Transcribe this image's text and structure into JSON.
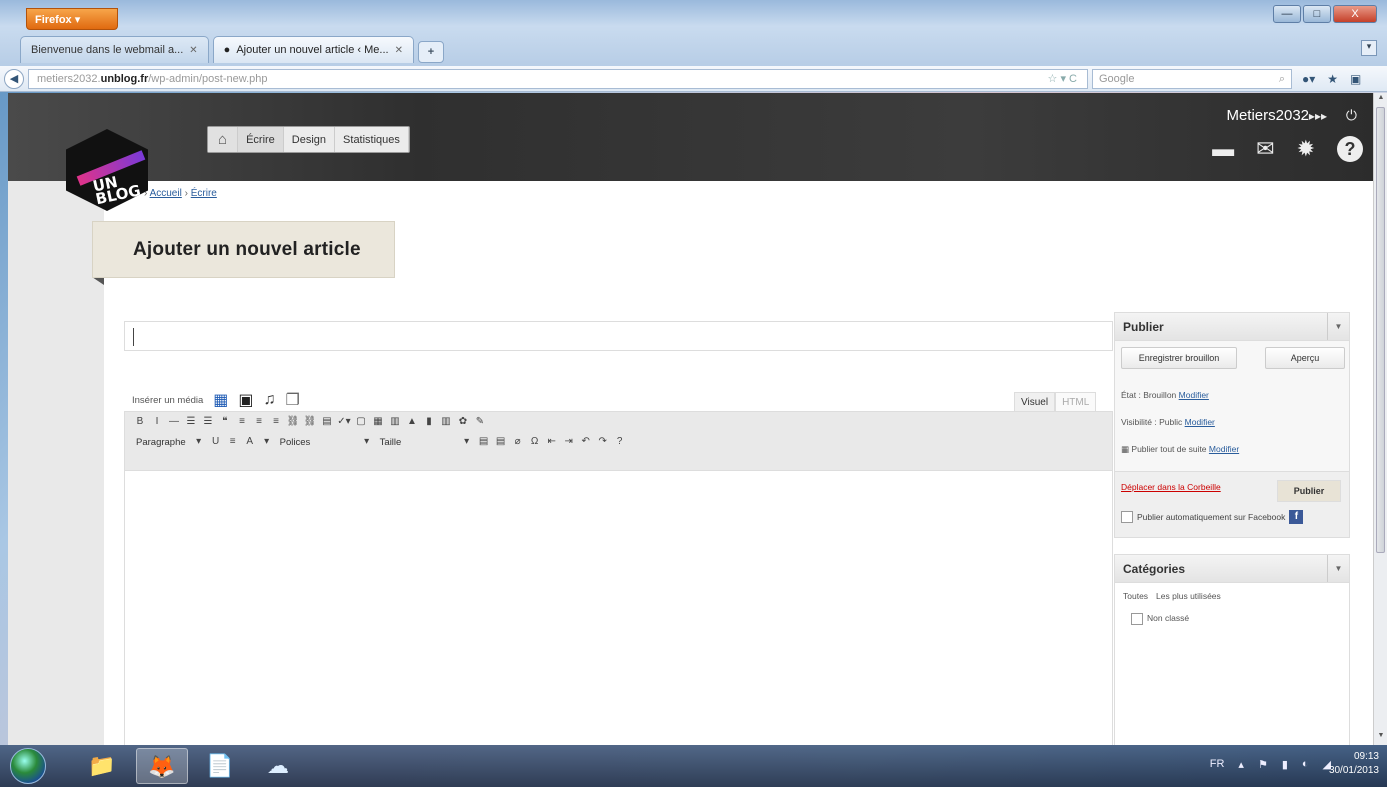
{
  "browser": {
    "menu_button": "Firefox ▾",
    "tabs": [
      {
        "label": "Bienvenue dans le webmail a...",
        "active": false
      },
      {
        "label": "Ajouter un nouvel article ‹ Me...",
        "active": true
      }
    ],
    "newtab_label": "+",
    "url_prefix": "metiers2032.",
    "url_domain": "unblog.fr",
    "url_path": "/wp-admin/post-new.php",
    "url_icons": "☆ ▾ C",
    "search_placeholder": "Google",
    "search_icon": "⌕",
    "window_controls": {
      "minimize": "—",
      "maximize": "□",
      "close": "X"
    },
    "nav_icons": [
      "⚲",
      "●▾",
      "★",
      "▣"
    ]
  },
  "site": {
    "logo_text": "UN BLOG",
    "menu": {
      "home_icon": "⌂",
      "items": [
        "Écrire",
        "Design",
        "Statistiques"
      ]
    },
    "username": "Metiers2032",
    "user_arrows": "▸▸▸",
    "power_icon": "⏻",
    "header_icons": [
      "▬",
      "✉",
      "✹",
      "?"
    ]
  },
  "breadcrumb": {
    "sep": "›",
    "items": [
      "Accueil",
      "Écrire"
    ]
  },
  "page_title": "Ajouter un nouvel article",
  "editor": {
    "media_label": "Insérer un média",
    "media_icons": [
      "▦",
      "▣",
      "♫",
      "❐"
    ],
    "tabs": {
      "visual": "Visuel",
      "html": "HTML"
    },
    "toolbar_row1": [
      "B",
      "I",
      "—",
      "☰",
      "☰",
      "❝",
      "≡",
      "≡",
      "≡",
      "⛓",
      "⛓",
      "▤",
      "✓▾",
      "▢",
      "▦",
      "▥",
      "▲",
      "▮",
      "▥",
      "✿",
      "✎"
    ],
    "toolbar_row2": {
      "format_select": "Paragraphe",
      "buttons_a": [
        "U",
        "≡",
        "A"
      ],
      "font_select": "Polices",
      "size_select": "Taille",
      "buttons_b": [
        "▤",
        "▤",
        "⌀",
        "Ω",
        "⇤",
        "⇥",
        "↶",
        "↷",
        "?"
      ]
    }
  },
  "publish": {
    "title": "Publier",
    "save_draft": "Enregistrer brouillon",
    "preview": "Aperçu",
    "status_label": "État : Brouillon",
    "visibility_label": "Visibilité : Public",
    "schedule_label": "Publier tout de suite",
    "modify": "Modifier",
    "trash": "Déplacer dans la Corbeille",
    "publish_button": "Publier",
    "facebook_label": "Publier automatiquement sur Facebook",
    "facebook_icon": "f"
  },
  "categories": {
    "title": "Catégories",
    "tabs": [
      "Toutes",
      "Les plus utilisées"
    ],
    "items": [
      "Non classé"
    ]
  },
  "taskbar": {
    "apps": [
      "📁",
      "🦊",
      "📄",
      "☁"
    ],
    "tray_lang": "FR",
    "tray_icons": [
      "▴",
      "⚑",
      "▮",
      "◐",
      "◢"
    ],
    "time": "09:13",
    "date": "30/01/2013"
  }
}
